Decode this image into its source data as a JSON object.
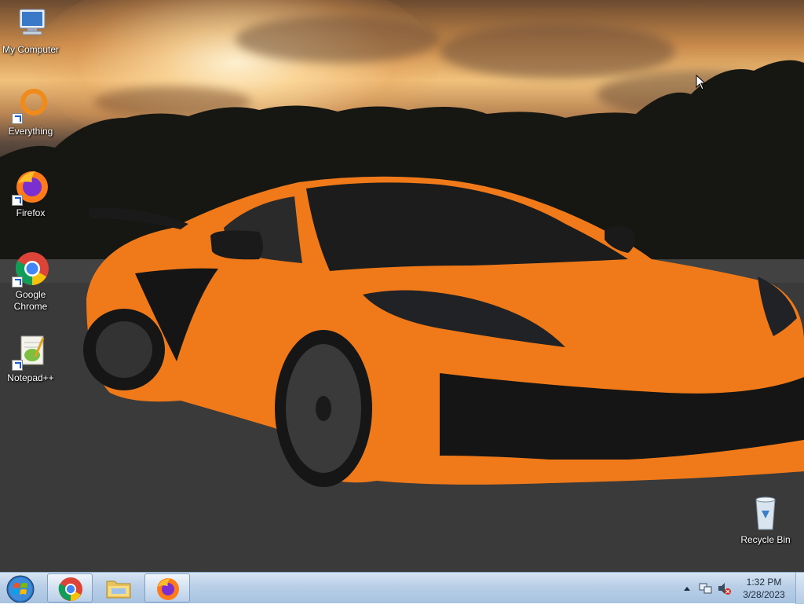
{
  "desktop": {
    "icons": [
      {
        "label": "My Computer",
        "icon": "computer-icon"
      },
      {
        "label": "Everything",
        "icon": "everything-search-icon"
      },
      {
        "label": "Firefox",
        "icon": "firefox-icon"
      },
      {
        "label": "Google Chrome",
        "icon": "chrome-icon"
      },
      {
        "label": "Notepad++",
        "icon": "notepad-plus-plus-icon"
      },
      {
        "label": "Recycle Bin",
        "icon": "recycle-bin-icon"
      }
    ]
  },
  "taskbar": {
    "start": {
      "icon": "windows-start-orb-icon"
    },
    "pinned": [
      {
        "name": "Google Chrome",
        "icon": "chrome-icon"
      },
      {
        "name": "Windows Explorer",
        "icon": "folder-icon"
      },
      {
        "name": "Firefox",
        "icon": "firefox-icon"
      }
    ],
    "tray": {
      "icons": [
        "show-hidden-icons-arrow",
        "network-icon",
        "volume-muted-icon"
      ]
    },
    "clock": {
      "time": "1:32 PM",
      "date": "3/28/2023"
    }
  },
  "colors": {
    "taskbar": "#b9cfe7",
    "car_orange": "#f07a1a",
    "accent_blue": "#1a5fd0"
  }
}
